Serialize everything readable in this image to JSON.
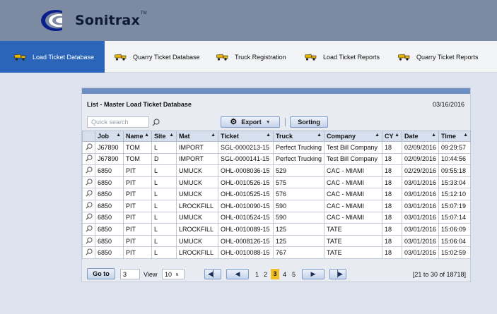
{
  "brand": {
    "name": "Sonitrax",
    "tm": "TM"
  },
  "nav": {
    "tabs": [
      {
        "label": "Load Ticket Database",
        "active": true
      },
      {
        "label": "Quarry Ticket Database",
        "active": false
      },
      {
        "label": "Truck Registration",
        "active": false
      },
      {
        "label": "Load Ticket Reports",
        "active": false
      },
      {
        "label": "Quarry Ticket Reports",
        "active": false
      }
    ]
  },
  "panel": {
    "title": "List - Master Load Ticket Database",
    "date": "03/16/2016",
    "search": {
      "placeholder": "Quick search",
      "value": ""
    },
    "export_label": "Export",
    "sorting_label": "Sorting"
  },
  "table": {
    "columns": [
      "Job",
      "Name",
      "Site",
      "Mat",
      "Ticket",
      "Truck",
      "Company",
      "CY",
      "Date",
      "Time"
    ],
    "rows": [
      [
        "J67890",
        "TOM",
        "L",
        "IMPORT",
        "SGL-0000213-15",
        "Perfect Trucking",
        "Test Bill Company",
        "18",
        "02/09/2016",
        "09:29:57"
      ],
      [
        "J67890",
        "TOM",
        "D",
        "IMPORT",
        "SGL-0000141-15",
        "Perfect Trucking",
        "Test Bill Company",
        "18",
        "02/09/2016",
        "10:44:56"
      ],
      [
        "6850",
        "PIT",
        "L",
        "UMUCK",
        "OHL-0008036-15",
        "529",
        "CAC - MIAMI",
        "18",
        "02/29/2016",
        "09:55:18"
      ],
      [
        "6850",
        "PIT",
        "L",
        "UMUCK",
        "OHL-0010526-15",
        "575",
        "CAC - MIAMI",
        "18",
        "03/01/2016",
        "15:33:04"
      ],
      [
        "6850",
        "PIT",
        "L",
        "UMUCK",
        "OHL-0010525-15",
        "576",
        "CAC - MIAMI",
        "18",
        "03/01/2016",
        "15:12:10"
      ],
      [
        "6850",
        "PIT",
        "L",
        "LROCKFILL",
        "OHL-0010090-15",
        "590",
        "CAC - MIAMI",
        "18",
        "03/01/2016",
        "15:07:19"
      ],
      [
        "6850",
        "PIT",
        "L",
        "UMUCK",
        "OHL-0010524-15",
        "590",
        "CAC - MIAMI",
        "18",
        "03/01/2016",
        "15:07:14"
      ],
      [
        "6850",
        "PIT",
        "L",
        "LROCKFILL",
        "OHL-0010089-15",
        "125",
        "TATE",
        "18",
        "03/01/2016",
        "15:06:09"
      ],
      [
        "6850",
        "PIT",
        "L",
        "UMUCK",
        "OHL-0008126-15",
        "125",
        "TATE",
        "18",
        "03/01/2016",
        "15:06:04"
      ],
      [
        "6850",
        "PIT",
        "L",
        "LROCKFILL",
        "OHL-0010088-15",
        "767",
        "TATE",
        "18",
        "03/01/2016",
        "15:02:59"
      ]
    ]
  },
  "pager": {
    "goto_label": "Go to",
    "page_value": "3",
    "view_label": "View",
    "view_value": "10",
    "pages": [
      "1",
      "2",
      "3",
      "4",
      "5"
    ],
    "current_page": "3",
    "range_text": "[21 to 30 of 18718]"
  },
  "colors": {
    "header_bg": "#7d8ba2",
    "nav_active": "#2a65b9",
    "panel_bar": "#6d8fc4",
    "current_page": "#f0c020"
  }
}
